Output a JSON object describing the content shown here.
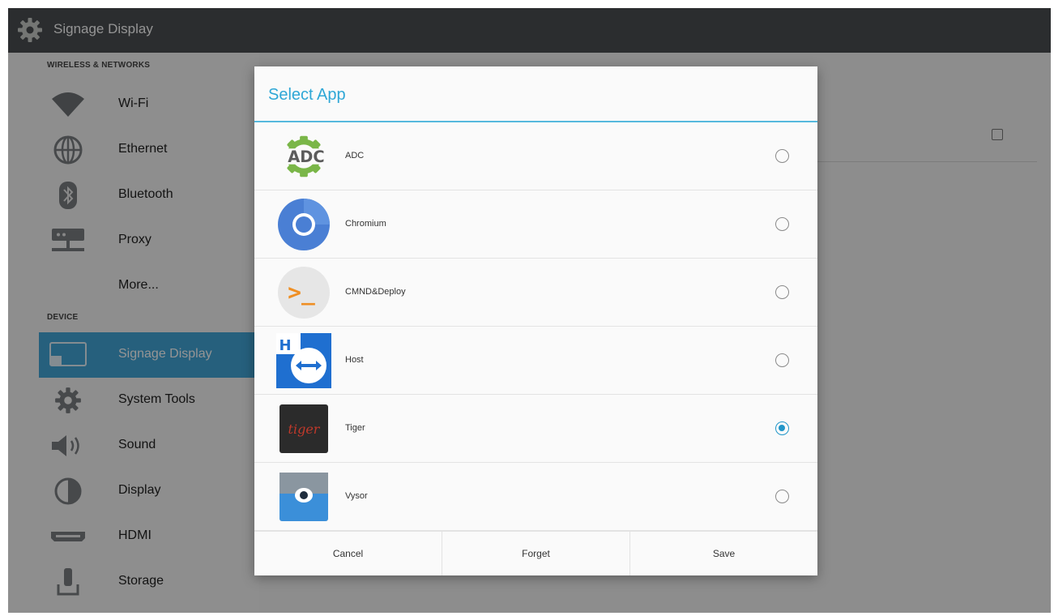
{
  "topbar": {
    "title": "Signage Display",
    "icon": "gear-icon"
  },
  "sidebar": {
    "sections": [
      {
        "header": "WIRELESS & NETWORKS"
      },
      {
        "header": "DEVICE"
      }
    ],
    "items": [
      {
        "label": "Wi-Fi",
        "icon": "wifi-icon"
      },
      {
        "label": "Ethernet",
        "icon": "ethernet-icon"
      },
      {
        "label": "Bluetooth",
        "icon": "bluetooth-icon"
      },
      {
        "label": "Proxy",
        "icon": "proxy-icon"
      },
      {
        "label": "More...",
        "icon": ""
      },
      {
        "label": "Signage Display",
        "icon": "signage-display-icon",
        "active": true
      },
      {
        "label": "System Tools",
        "icon": "gear-icon"
      },
      {
        "label": "Sound",
        "icon": "speaker-icon"
      },
      {
        "label": "Display",
        "icon": "contrast-icon"
      },
      {
        "label": "HDMI",
        "icon": "hdmi-icon"
      },
      {
        "label": "Storage",
        "icon": "storage-icon"
      }
    ]
  },
  "dialog": {
    "title": "Select App",
    "apps": [
      {
        "name": "ADC",
        "logo_text": "ADC",
        "selected": false
      },
      {
        "name": "Chromium",
        "selected": false
      },
      {
        "name": "CMND&Deploy",
        "logo_text": ">_",
        "selected": false
      },
      {
        "name": "Host",
        "logo_text": "H",
        "selected": false
      },
      {
        "name": "Tiger",
        "logo_text": "tiger",
        "selected": true
      },
      {
        "name": "Vysor",
        "selected": false
      }
    ],
    "buttons": {
      "cancel": "Cancel",
      "forget": "Forget",
      "save": "Save"
    }
  },
  "colors": {
    "accent": "#2ea7d6",
    "active_item": "#42a5d8",
    "topbar": "#4a4e52",
    "radio_checked": "#2196c9"
  }
}
